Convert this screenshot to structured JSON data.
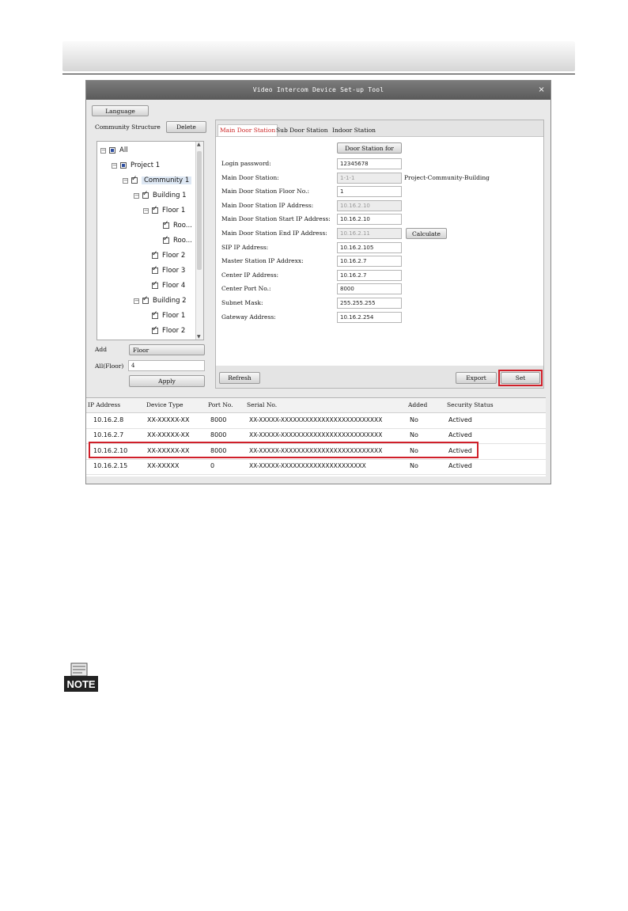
{
  "window": {
    "title": "Video Intercom Device Set-up Tool",
    "close_glyph": "×"
  },
  "toolbar": {
    "language": "Language"
  },
  "left": {
    "community_structure": "Community Structure",
    "delete": "Delete",
    "tree": [
      {
        "label": "All",
        "state": "part",
        "exp": "−"
      },
      {
        "label": "Project 1",
        "state": "part",
        "exp": "−"
      },
      {
        "label": "Community 1",
        "state": "chk",
        "exp": "−",
        "selected": true
      },
      {
        "label": "Building 1",
        "state": "chk",
        "exp": "−"
      },
      {
        "label": "Floor 1",
        "state": "chk",
        "exp": "−"
      },
      {
        "label": "Roo...",
        "state": "chk"
      },
      {
        "label": "Roo...",
        "state": "chk"
      },
      {
        "label": "Floor 2",
        "state": "chk"
      },
      {
        "label": "Floor 3",
        "state": "chk"
      },
      {
        "label": "Floor 4",
        "state": "chk"
      },
      {
        "label": "Building 2",
        "state": "chk",
        "exp": "−"
      },
      {
        "label": "Floor 1",
        "state": "chk"
      },
      {
        "label": "Floor 2",
        "state": "chk"
      }
    ],
    "add_label": "Add",
    "add_value": "Floor",
    "all_floor_label": "All(Floor)",
    "all_floor_value": "4",
    "apply": "Apply"
  },
  "tabs": [
    "Main Door Station",
    "Sub Door Station",
    "Indoor Station"
  ],
  "form": {
    "door_station_for": "Door Station for",
    "rows": [
      {
        "label": "Login password:",
        "value": "12345678"
      },
      {
        "label": "Main Door Station:",
        "value": "1-1-1",
        "disabled": true,
        "extra": "Project-Community-Building"
      },
      {
        "label": "Main Door Station Floor No.:",
        "value": "1"
      },
      {
        "label": "Main Door Station IP Address:",
        "value": "10.16.2.10",
        "disabled": true
      },
      {
        "label": "Main Door Station Start IP Address:",
        "value": "10.16.2.10"
      },
      {
        "label": "Main Door Station End IP Address:",
        "value": "10.16.2.11",
        "disabled": true
      },
      {
        "label": "SIP IP Address:",
        "value": "10.16.2.105"
      },
      {
        "label": "Master Station IP Addrexx:",
        "value": "10.16.2.7"
      },
      {
        "label": "Center IP Address:",
        "value": "10.16.2.7"
      },
      {
        "label": "Center Port No.:",
        "value": "8000"
      },
      {
        "label": "Subnet Mask:",
        "value": "255.255.255"
      },
      {
        "label": "Gateway Address:",
        "value": "10.16.2.254"
      }
    ],
    "calculate": "Calculate",
    "refresh": "Refresh",
    "export": "Export",
    "set": "Set"
  },
  "device_list": {
    "columns": [
      "IP Address",
      "Device Type",
      "Port No.",
      "Serial No.",
      "Added",
      "Security Status"
    ],
    "rows": [
      [
        "10.16.2.8",
        "XX-XXXXX-XX",
        "8000",
        "XX-XXXXX-XXXXXXXXXXXXXXXXXXXXXXXXX",
        "No",
        "Actived"
      ],
      [
        "10.16.2.7",
        "XX-XXXXX-XX",
        "8000",
        "XX-XXXXX-XXXXXXXXXXXXXXXXXXXXXXXXX",
        "No",
        "Actived"
      ],
      [
        "10.16.2.10",
        "XX-XXXXX-XX",
        "8000",
        "XX-XXXXX-XXXXXXXXXXXXXXXXXXXXXXXXX",
        "No",
        "Actived"
      ],
      [
        "10.16.2.15",
        "XX-XXXXX",
        "0",
        "XX-XXXXX-XXXXXXXXXXXXXXXXXXXXX",
        "No",
        "Actived"
      ]
    ]
  },
  "note": {
    "label": "NOTE"
  },
  "colors": {
    "highlight": "#d0202a",
    "active_tab": "#cc2222",
    "partial_check": "#2d4ea0"
  }
}
